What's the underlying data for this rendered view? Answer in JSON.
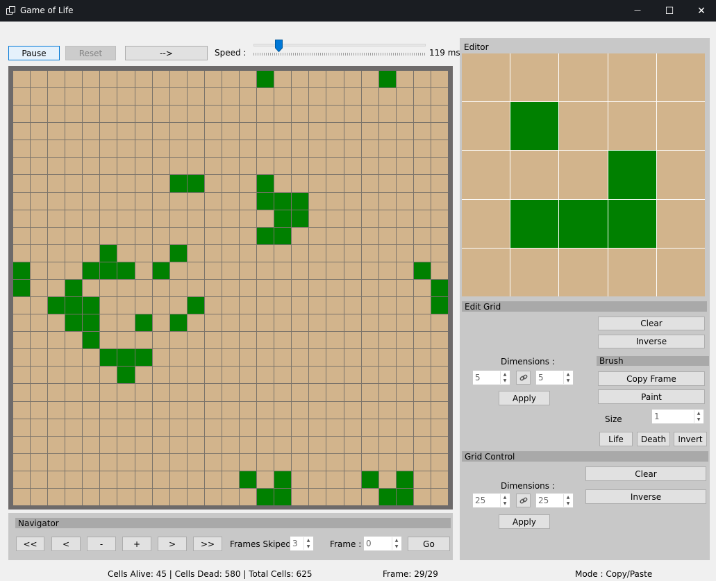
{
  "window": {
    "title": "Game of Life",
    "minimize_glyph": "—",
    "maximize_glyph": "☐",
    "close_glyph": "✕",
    "icon": "grid-window-icon"
  },
  "toolbar": {
    "pause_label": "Pause",
    "reset_label": "Reset",
    "step_label": "-->",
    "speed_label": "Speed :",
    "speed_value": "119 ms",
    "speed_slider_fraction": 0.13
  },
  "board": {
    "rows": 25,
    "cols": 25,
    "alive_color": "#008000",
    "dead_color": "#d2b48c",
    "alive": [
      [
        0,
        14
      ],
      [
        0,
        21
      ],
      [
        6,
        9
      ],
      [
        6,
        10
      ],
      [
        6,
        14
      ],
      [
        7,
        14
      ],
      [
        7,
        15
      ],
      [
        7,
        16
      ],
      [
        8,
        15
      ],
      [
        8,
        16
      ],
      [
        9,
        14
      ],
      [
        9,
        15
      ],
      [
        10,
        5
      ],
      [
        10,
        9
      ],
      [
        11,
        0
      ],
      [
        11,
        4
      ],
      [
        11,
        5
      ],
      [
        11,
        6
      ],
      [
        11,
        8
      ],
      [
        11,
        23
      ],
      [
        12,
        0
      ],
      [
        12,
        3
      ],
      [
        12,
        24
      ],
      [
        13,
        2
      ],
      [
        13,
        3
      ],
      [
        13,
        4
      ],
      [
        13,
        10
      ],
      [
        13,
        24
      ],
      [
        14,
        3
      ],
      [
        14,
        4
      ],
      [
        14,
        7
      ],
      [
        14,
        9
      ],
      [
        15,
        4
      ],
      [
        16,
        5
      ],
      [
        16,
        6
      ],
      [
        16,
        7
      ],
      [
        17,
        6
      ],
      [
        23,
        13
      ],
      [
        23,
        15
      ],
      [
        23,
        20
      ],
      [
        23,
        22
      ],
      [
        24,
        14
      ],
      [
        24,
        15
      ],
      [
        24,
        21
      ],
      [
        24,
        22
      ]
    ]
  },
  "editor": {
    "title": "Editor",
    "rows": 5,
    "cols": 5,
    "alive": [
      [
        1,
        1
      ],
      [
        2,
        3
      ],
      [
        3,
        1
      ],
      [
        3,
        2
      ],
      [
        3,
        3
      ]
    ]
  },
  "edit_grid": {
    "header": "Edit Grid",
    "clear_label": "Clear",
    "inverse_label": "Inverse",
    "dimensions_label": "Dimensions :",
    "width": "5",
    "height": "5",
    "apply_label": "Apply",
    "brush_header": "Brush",
    "copy_frame_label": "Copy Frame",
    "paint_label": "Paint",
    "size_label": "Size",
    "size_value": "1",
    "life_label": "Life",
    "death_label": "Death",
    "invert_label": "Invert"
  },
  "grid_control": {
    "header": "Grid Control",
    "dimensions_label": "Dimensions :",
    "width": "25",
    "height": "25",
    "apply_label": "Apply",
    "clear_label": "Clear",
    "inverse_label": "Inverse"
  },
  "navigator": {
    "header": "Navigator",
    "first_label": "<<",
    "prev_label": "<",
    "minus_label": "-",
    "plus_label": "+",
    "next_label": ">",
    "last_label": ">>",
    "frames_skipped_label": "Frames Skiped :",
    "frames_skipped_value": "3",
    "frame_label": "Frame :",
    "frame_value": "0",
    "go_label": "Go"
  },
  "status": {
    "cells": "Cells Alive: 45 | Cells Dead: 580 | Total Cells: 625",
    "frame": "Frame: 29/29",
    "mode": "Mode : Copy/Paste"
  }
}
